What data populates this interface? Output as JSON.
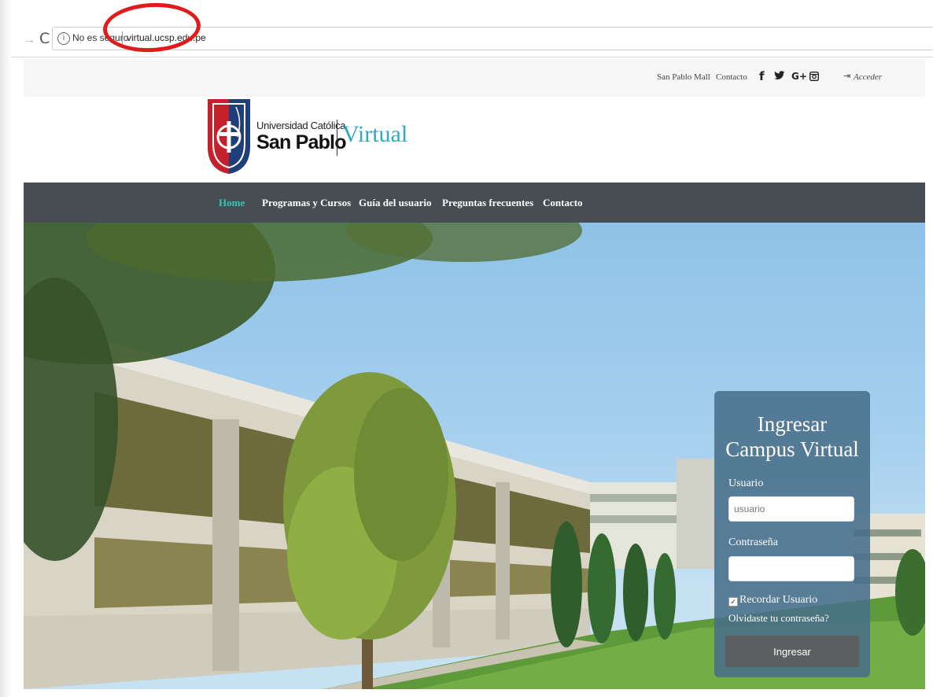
{
  "browser": {
    "security_text": "No es seguro",
    "url": "virtual.ucsp.edu.pe",
    "info_glyph": "i",
    "back_glyph": "→",
    "reload_glyph": "C"
  },
  "topbar": {
    "links": [
      "San Pablo Mall",
      "Contacto"
    ],
    "social": {
      "facebook": "f",
      "twitter": "🐦",
      "googleplus": "G+",
      "instagram": "◙"
    },
    "login_link": "Acceder",
    "login_glyph": "⇥"
  },
  "logo": {
    "line1": "Universidad Católica",
    "line2": "San Pablo",
    "virtual": "Virtual"
  },
  "nav": {
    "items": [
      "Home",
      "Programas y Cursos",
      "Guía del usuario",
      "Preguntas frecuentes",
      "Contacto"
    ]
  },
  "login": {
    "title_line1": "Ingresar",
    "title_line2": "Campus Virtual",
    "user_label": "Usuario",
    "user_placeholder": "usuario",
    "password_label": "Contraseña",
    "remember_label": "Recordar Usuario",
    "forgot_link": "Olvidaste tu contraseña?",
    "submit_label": "Ingresar",
    "check_glyph": "✓"
  },
  "colors": {
    "accent": "#39c3b2",
    "virtual_text": "#2fa8c4",
    "nav_bg": "#464e53",
    "annotation": "#e01b1b"
  }
}
